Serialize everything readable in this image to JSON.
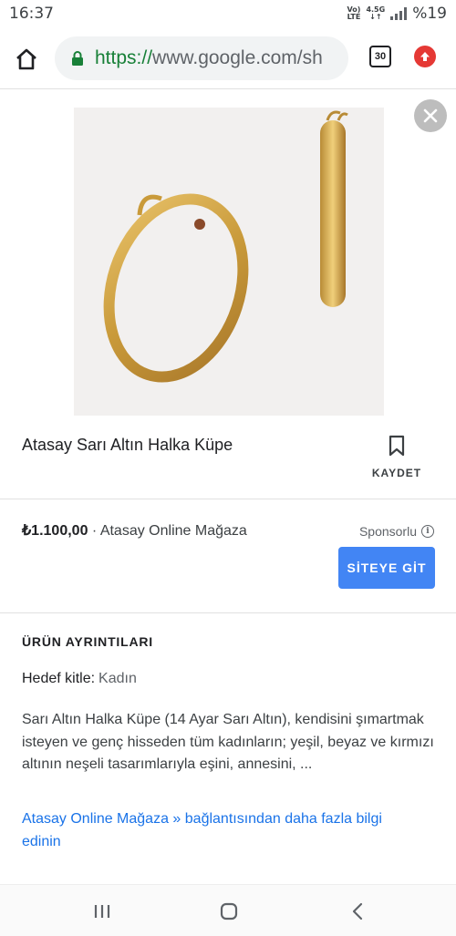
{
  "status_bar": {
    "time": "16:37",
    "network_top": "Vo)",
    "network_bottom": "LTE",
    "data_top": "4.5G",
    "data_bottom": "↓↑",
    "battery": "%19"
  },
  "browser": {
    "url_scheme": "https://",
    "url_rest": "www.google.com/sh",
    "tab_count": "30",
    "icons": [
      "home-icon",
      "lock-icon",
      "tabs-icon",
      "update-icon"
    ]
  },
  "product": {
    "title": "Atasay Sarı Altın Halka Küpe",
    "save_label": "KAYDET",
    "price": "₺1.100,00",
    "seller": "· Atasay Online Mağaza",
    "sponsored_label": "Sponsorlu",
    "site_button_label": "SİTEYE GİT"
  },
  "details": {
    "section_title": "ÜRÜN AYRINTILARI",
    "audience_label": "Hedef kitle:",
    "audience_value": "Kadın",
    "description": "Sarı Altın Halka Küpe (14 Ayar Sarı Altın), kendisini şımartmak isteyen ve genç hisseden tüm kadınların; yeşil, beyaz ve kırmızı altının neşeli tasarımlarıyla eşini, annesini, ...",
    "more_link": "Atasay Online Mağaza » bağlantısından daha fazla bilgi edinin"
  },
  "colors": {
    "accent": "#4285f4",
    "link": "#1a73e8",
    "secure": "#188038",
    "gold": "#c99a3a"
  }
}
